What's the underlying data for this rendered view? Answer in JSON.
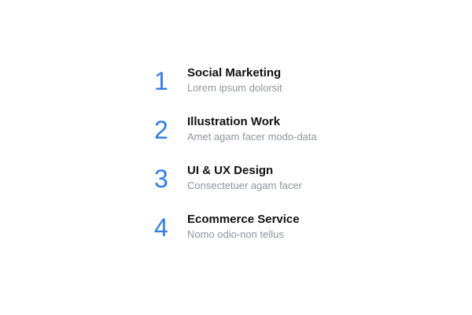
{
  "accent_color": "#2b7df0",
  "title_color": "#111111",
  "description_color": "#8e93a0",
  "services": [
    {
      "number": "1",
      "title": "Social Marketing",
      "description": "Lorem ipsum dolorsit"
    },
    {
      "number": "2",
      "title": "Illustration Work",
      "description": "Amet agam facer modo-data"
    },
    {
      "number": "3",
      "title": "UI & UX Design",
      "description": "Consectetuer agam facer"
    },
    {
      "number": "4",
      "title": "Ecommerce Service",
      "description": "Nomo odio-non tellus"
    }
  ]
}
